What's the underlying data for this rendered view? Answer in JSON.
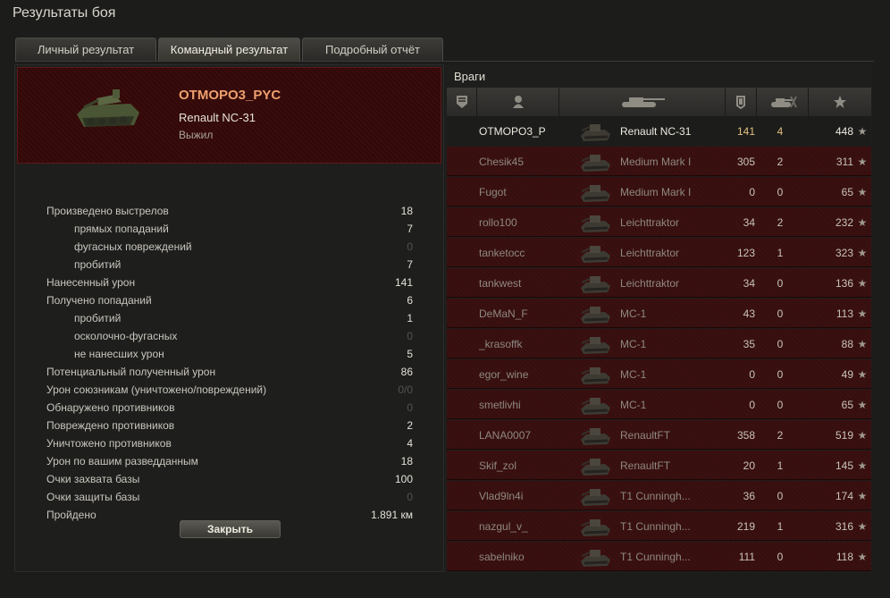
{
  "title": "Результаты боя",
  "tabs": [
    {
      "label": "Личный результат",
      "active": false
    },
    {
      "label": "Командный результат",
      "active": true
    },
    {
      "label": "Подробный отчёт",
      "active": false
    }
  ],
  "player": {
    "name": "OTMOPO3_PYC",
    "tank": "Renault NC-31",
    "status": "Выжил"
  },
  "stats": [
    {
      "label": "Произведено выстрелов",
      "value": "18"
    },
    {
      "label": "прямых попаданий",
      "value": "7"
    },
    {
      "label": "фугасных повреждений",
      "value": "0"
    },
    {
      "label": "пробитий",
      "value": "7"
    },
    {
      "label": "Нанесенный урон",
      "value": "141"
    },
    {
      "label": "Получено попаданий",
      "value": "6"
    },
    {
      "label": "пробитий",
      "value": "1"
    },
    {
      "label": "осколочно-фугасных",
      "value": "0"
    },
    {
      "label": "не нанесших урон",
      "value": "5"
    },
    {
      "label": "Потенциальный полученный урон",
      "value": "86"
    },
    {
      "label": "Урон союзникам (уничтожено/повреждений)",
      "value": "0/0"
    },
    {
      "label": "Обнаружено противников",
      "value": "0"
    },
    {
      "label": "Повреждено противников",
      "value": "2"
    },
    {
      "label": "Уничтожено противников",
      "value": "4"
    },
    {
      "label": "Урон по вашим разведданным",
      "value": "18"
    },
    {
      "label": "Очки захвата базы",
      "value": "100"
    },
    {
      "label": "Очки защиты базы",
      "value": "0"
    },
    {
      "label": "Пройдено",
      "value": "1.891 км"
    }
  ],
  "close_label": "Закрыть",
  "enemies": {
    "title": "Враги",
    "columns": [
      "squad-icon",
      "player-icon",
      "tank-icon",
      "damage-icon",
      "frags-icon",
      "xp-star-icon"
    ],
    "rows": [
      {
        "name": "OTMOPO3_P",
        "tank": "Renault NC-31",
        "damage": "141",
        "frags": "4",
        "xp": "448",
        "self": true
      },
      {
        "name": "Chesik45",
        "tank": "Medium Mark I",
        "damage": "305",
        "frags": "2",
        "xp": "311",
        "self": false
      },
      {
        "name": "Fugot",
        "tank": "Medium Mark I",
        "damage": "0",
        "frags": "0",
        "xp": "65",
        "self": false
      },
      {
        "name": "rollo100",
        "tank": "Leichttraktor",
        "damage": "34",
        "frags": "2",
        "xp": "232",
        "self": false
      },
      {
        "name": "tanketocc",
        "tank": "Leichttraktor",
        "damage": "123",
        "frags": "1",
        "xp": "323",
        "self": false
      },
      {
        "name": "tankwest",
        "tank": "Leichttraktor",
        "damage": "34",
        "frags": "0",
        "xp": "136",
        "self": false
      },
      {
        "name": "DeMaN_F",
        "tank": "MC-1",
        "damage": "43",
        "frags": "0",
        "xp": "113",
        "self": false
      },
      {
        "name": "_krasoffk",
        "tank": "MC-1",
        "damage": "35",
        "frags": "0",
        "xp": "88",
        "self": false
      },
      {
        "name": "egor_wine",
        "tank": "MC-1",
        "damage": "0",
        "frags": "0",
        "xp": "49",
        "self": false
      },
      {
        "name": "smetlivhi",
        "tank": "MC-1",
        "damage": "0",
        "frags": "0",
        "xp": "65",
        "self": false
      },
      {
        "name": "LANA0007",
        "tank": "RenaultFT",
        "damage": "358",
        "frags": "2",
        "xp": "519",
        "self": false
      },
      {
        "name": "Skif_zol",
        "tank": "RenaultFT",
        "damage": "20",
        "frags": "1",
        "xp": "145",
        "self": false
      },
      {
        "name": "Vlad9ln4i",
        "tank": "T1 Cunningh...",
        "damage": "36",
        "frags": "0",
        "xp": "174",
        "self": false
      },
      {
        "name": "nazgul_v_",
        "tank": "T1 Cunningh...",
        "damage": "219",
        "frags": "1",
        "xp": "316",
        "self": false
      },
      {
        "name": "sabelniko",
        "tank": "T1 Cunningh...",
        "damage": "111",
        "frags": "0",
        "xp": "118",
        "self": false
      }
    ]
  },
  "colors": {
    "accent": "#ee9f6e",
    "enemy_row": "#3e0f0f",
    "self_value": "#e0c080"
  }
}
